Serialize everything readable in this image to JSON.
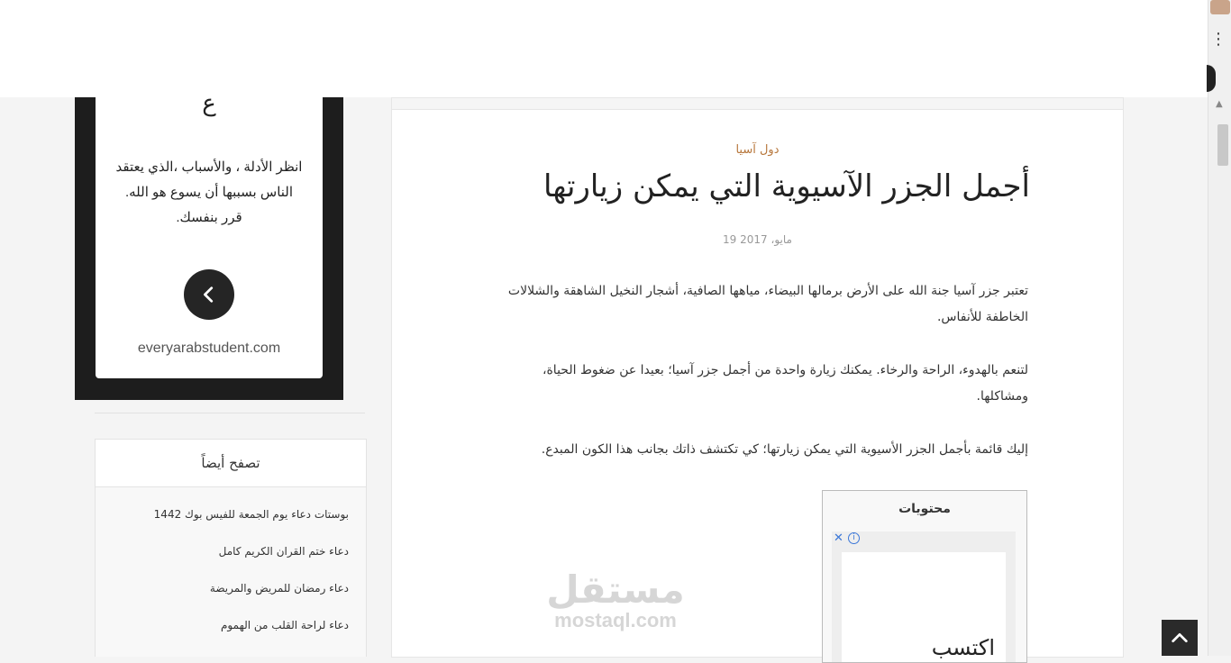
{
  "sidebar_widget": {
    "top_glyph": "ع",
    "text": "انظر الأدلة ، والأسباب ،الذي يعتقد الناس بسببها أن يسوع هو الله. قرر بنفسك.",
    "back_icon": "chevron-left-icon",
    "domain": "everyarabstudent.com"
  },
  "browse_also": {
    "title": "تصفح أيضاً",
    "items": [
      "بوستات دعاء يوم الجمعة للفيس بوك 1442",
      "دعاء ختم القران الكريم كامل",
      "دعاء رمضان للمريض والمريضة",
      "دعاء لراحة القلب من الهموم"
    ]
  },
  "article": {
    "category": "دول آسيا",
    "title": "أجمل الجزر الآسيوية التي يمكن زيارتها",
    "date": "19 مايو، 2017",
    "paragraphs": [
      "تعتبر جزر آسيا جنة الله على الأرض برمالها البيضاء، مياهها الصافية، أشجار النخيل الشاهقة والشلالات الخاطفة للأنفاس.",
      "لتنعم بالهدوء، الراحة والرخاء. يمكنك زيارة واحدة من أجمل جزر آسيا؛ بعيدا عن ضغوط الحياة، ومشاكلها.",
      "إليك قائمة بأجمل الجزر الأسيوية التي يمكن زيارتها؛ كي تكتشف ذاتك بجانب هذا الكون المبدع."
    ],
    "toc": {
      "title": "محتويات",
      "ad_text": "اكتسب"
    }
  },
  "watermark": {
    "arabic": "مستقل",
    "latin": "mostaql.com"
  },
  "colors": {
    "category": "#b7773c",
    "dark_widget": "#1d1d1d",
    "ad_accent": "#3b77d8"
  }
}
